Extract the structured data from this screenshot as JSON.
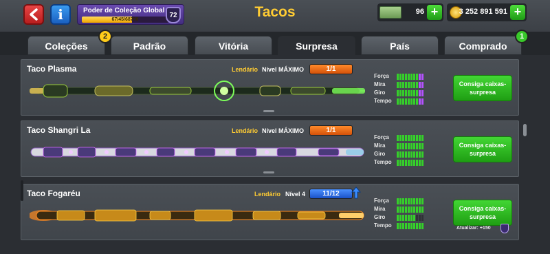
{
  "header": {
    "title": "Tacos",
    "power_label": "Poder de Coleção Global",
    "power_value": "67/45/68700",
    "power_progress": 0.58,
    "power_level": "72",
    "cash": "96",
    "coins": "3 252 891 591"
  },
  "tabs": [
    {
      "label": "Coleções",
      "badge": "2"
    },
    {
      "label": "Padrão"
    },
    {
      "label": "Vitória"
    },
    {
      "label": "Surpresa",
      "active": true
    },
    {
      "label": "País"
    },
    {
      "label": "Comprado",
      "badge": "1"
    }
  ],
  "stat_labels": {
    "force": "Força",
    "aim": "Mira",
    "spin": "Giro",
    "time": "Tempo"
  },
  "cues": [
    {
      "name": "Taco Plasma",
      "rarity": "Lendário",
      "level": "Nível MÁXIMO",
      "count": "1/1",
      "cta": "Consiga caixas-surpresa",
      "stats": {
        "force": [
          8,
          2
        ],
        "aim": [
          8,
          2
        ],
        "spin": [
          8,
          2
        ],
        "time": [
          8,
          2
        ]
      },
      "theme": "plasma"
    },
    {
      "name": "Taco Shangri La",
      "rarity": "Lendário",
      "level": "Nível MÁXIMO",
      "count": "1/1",
      "cta": "Consiga caixas-surpresa",
      "stats": {
        "force": [
          10,
          0
        ],
        "aim": [
          10,
          0
        ],
        "spin": [
          10,
          0
        ],
        "time": [
          10,
          0
        ]
      },
      "theme": "shangri"
    },
    {
      "name": "Taco Fogaréu",
      "rarity": "Lendário",
      "level": "Nível 4",
      "count": "11/12",
      "cta": "Consiga caixas-surpresa",
      "upgrade": "Atualizar: +150",
      "stats": {
        "force": [
          10,
          0
        ],
        "aim": [
          10,
          0
        ],
        "spin": [
          7,
          0
        ],
        "time": [
          10,
          0
        ]
      },
      "theme": "fire"
    }
  ],
  "colors": {
    "accent": "#ffcc33",
    "cta_green": "#35d12a",
    "plasma": "#7dff5a",
    "shangri": "#d86cff",
    "fire": "#ff8a1e"
  }
}
